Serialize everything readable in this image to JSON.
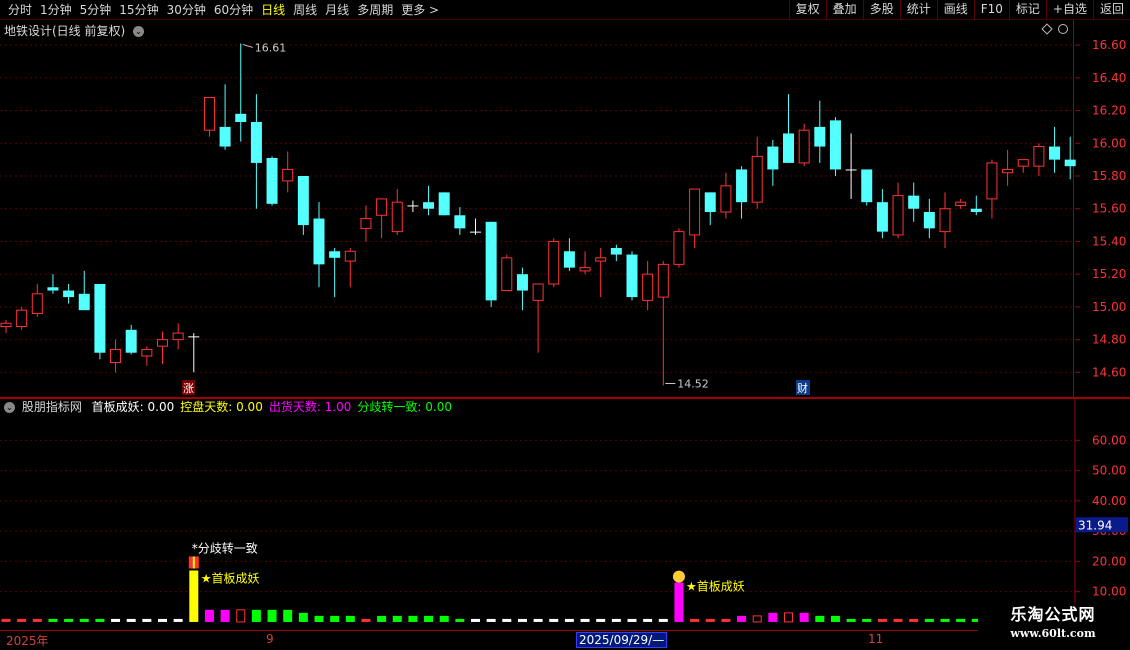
{
  "toolbar": {
    "periods": [
      {
        "label": "分时",
        "active": false
      },
      {
        "label": "1分钟",
        "active": false
      },
      {
        "label": "5分钟",
        "active": false
      },
      {
        "label": "15分钟",
        "active": false
      },
      {
        "label": "30分钟",
        "active": false
      },
      {
        "label": "60分钟",
        "active": false
      },
      {
        "label": "日线",
        "active": true
      },
      {
        "label": "周线",
        "active": false
      },
      {
        "label": "月线",
        "active": false
      },
      {
        "label": "多周期",
        "active": false
      },
      {
        "label": "更多 >",
        "active": false
      }
    ],
    "right_buttons": [
      "复权",
      "叠加",
      "多股",
      "统计",
      "画线",
      "F10",
      "标记",
      "+自选",
      "返回"
    ]
  },
  "main_chart": {
    "title": "地铁设计(日线 前复权)",
    "high_label": "16.61",
    "low_label": "14.52",
    "marker_zhang": "涨",
    "marker_cai": "财",
    "colors": {
      "up": "#ff3232",
      "down": "#54ffff",
      "flat": "#ffffff"
    }
  },
  "indicator": {
    "name": "股朋指标网",
    "items": [
      {
        "label": "首板成妖: 0.00",
        "color": "#ffffff"
      },
      {
        "label": "控盘天数: 0.00",
        "color": "#ffff00"
      },
      {
        "label": "出货天数: 1.00",
        "color": "#ff00ff"
      },
      {
        "label": "分歧转一致: 0.00",
        "color": "#00ff00"
      }
    ],
    "annotation_divergence": "*分歧转一致",
    "annotation_first_board_1": "★首板成妖",
    "annotation_first_board_2": "★首板成妖",
    "current_value": "31.94"
  },
  "date_axis": {
    "year_label": "2025年",
    "month_9": "9",
    "selected_date": "2025/09/29/—",
    "month_11": "11"
  },
  "watermark": {
    "line1": "乐淘公式网",
    "line2": "www.60lt.com"
  },
  "chart_data": {
    "type": "candlestick",
    "price_axis": {
      "ticks": [
        "16.60",
        "16.40",
        "16.20",
        "16.00",
        "15.80",
        "15.60",
        "15.40",
        "15.20",
        "15.00",
        "14.80",
        "14.60"
      ],
      "range": [
        14.48,
        16.68
      ]
    },
    "candles": [
      [
        14.88,
        14.92,
        14.84,
        14.9
      ],
      [
        14.88,
        15.0,
        14.86,
        14.98
      ],
      [
        14.96,
        15.14,
        14.94,
        15.08
      ],
      [
        15.12,
        15.2,
        15.08,
        15.1
      ],
      [
        15.1,
        15.14,
        15.02,
        15.06
      ],
      [
        15.08,
        15.22,
        15.02,
        14.98
      ],
      [
        15.14,
        15.14,
        14.68,
        14.72
      ],
      [
        14.66,
        14.8,
        14.6,
        14.74
      ],
      [
        14.86,
        14.89,
        14.71,
        14.72
      ],
      [
        14.7,
        14.76,
        14.64,
        14.74
      ],
      [
        14.76,
        14.85,
        14.65,
        14.8
      ],
      [
        14.8,
        14.9,
        14.74,
        14.84
      ],
      [
        14.82,
        14.84,
        14.6,
        14.82
      ],
      [
        16.08,
        16.28,
        16.04,
        16.28
      ],
      [
        16.1,
        16.36,
        15.96,
        15.98
      ],
      [
        16.18,
        16.61,
        16.01,
        16.13
      ],
      [
        16.13,
        16.3,
        15.6,
        15.88
      ],
      [
        15.91,
        15.92,
        15.62,
        15.63
      ],
      [
        15.77,
        15.95,
        15.7,
        15.84
      ],
      [
        15.8,
        15.8,
        15.44,
        15.5
      ],
      [
        15.54,
        15.64,
        15.12,
        15.26
      ],
      [
        15.34,
        15.36,
        15.06,
        15.3
      ],
      [
        15.28,
        15.36,
        15.12,
        15.34
      ],
      [
        15.48,
        15.62,
        15.4,
        15.54
      ],
      [
        15.56,
        15.66,
        15.42,
        15.66
      ],
      [
        15.46,
        15.72,
        15.44,
        15.64
      ],
      [
        15.62,
        15.65,
        15.58,
        15.62
      ],
      [
        15.64,
        15.74,
        15.56,
        15.6
      ],
      [
        15.7,
        15.7,
        15.56,
        15.56
      ],
      [
        15.56,
        15.61,
        15.44,
        15.48
      ],
      [
        15.46,
        15.54,
        15.44,
        15.46
      ],
      [
        15.52,
        15.52,
        15.0,
        15.04
      ],
      [
        15.1,
        15.32,
        15.1,
        15.3
      ],
      [
        15.2,
        15.24,
        14.98,
        15.1
      ],
      [
        15.04,
        15.14,
        14.72,
        15.14
      ],
      [
        15.14,
        15.42,
        15.12,
        15.4
      ],
      [
        15.34,
        15.42,
        15.22,
        15.24
      ],
      [
        15.22,
        15.34,
        15.2,
        15.24
      ],
      [
        15.28,
        15.36,
        15.06,
        15.3
      ],
      [
        15.36,
        15.38,
        15.28,
        15.32
      ],
      [
        15.32,
        15.34,
        15.04,
        15.06
      ],
      [
        15.04,
        15.28,
        14.98,
        15.2
      ],
      [
        15.06,
        15.28,
        14.52,
        15.26
      ],
      [
        15.26,
        15.48,
        15.24,
        15.46
      ],
      [
        15.44,
        15.72,
        15.36,
        15.72
      ],
      [
        15.7,
        15.7,
        15.5,
        15.58
      ],
      [
        15.58,
        15.82,
        15.54,
        15.74
      ],
      [
        15.84,
        15.86,
        15.54,
        15.64
      ],
      [
        15.64,
        16.04,
        15.6,
        15.92
      ],
      [
        15.98,
        16.02,
        15.74,
        15.84
      ],
      [
        16.06,
        16.3,
        15.9,
        15.88
      ],
      [
        15.88,
        16.12,
        15.86,
        16.08
      ],
      [
        16.1,
        16.26,
        15.88,
        15.98
      ],
      [
        16.14,
        16.16,
        15.8,
        15.84
      ],
      [
        15.84,
        16.06,
        15.66,
        15.84
      ],
      [
        15.84,
        15.84,
        15.62,
        15.64
      ],
      [
        15.64,
        15.72,
        15.42,
        15.46
      ],
      [
        15.44,
        15.76,
        15.42,
        15.68
      ],
      [
        15.68,
        15.76,
        15.52,
        15.6
      ],
      [
        15.58,
        15.66,
        15.42,
        15.48
      ],
      [
        15.46,
        15.7,
        15.36,
        15.6
      ],
      [
        15.62,
        15.66,
        15.6,
        15.64
      ],
      [
        15.6,
        15.68,
        15.56,
        15.58
      ],
      [
        15.66,
        15.9,
        15.54,
        15.88
      ],
      [
        15.82,
        15.96,
        15.74,
        15.84
      ],
      [
        15.86,
        15.9,
        15.82,
        15.9
      ],
      [
        15.86,
        16.0,
        15.8,
        15.98
      ],
      [
        15.98,
        16.1,
        15.82,
        15.9
      ],
      [
        15.9,
        16.04,
        15.78,
        15.86
      ]
    ],
    "indicator": {
      "axis_ticks": [
        "60.00",
        "50.00",
        "40.00",
        "30.00",
        "20.00",
        "10.00"
      ],
      "range": [
        -2,
        72
      ],
      "bars": [
        {
          "v": 1,
          "c": "red"
        },
        {
          "v": 1,
          "c": "red"
        },
        {
          "v": 1,
          "c": "red"
        },
        {
          "v": 1,
          "c": "green"
        },
        {
          "v": 1,
          "c": "green"
        },
        {
          "v": 1,
          "c": "green"
        },
        {
          "v": 1,
          "c": "green"
        },
        {
          "v": 1,
          "c": "white"
        },
        {
          "v": 1,
          "c": "white"
        },
        {
          "v": 1,
          "c": "white"
        },
        {
          "v": 1,
          "c": "white"
        },
        {
          "v": 1,
          "c": "white"
        },
        {
          "v": 17,
          "c": "yellow"
        },
        {
          "v": 4,
          "c": "magenta"
        },
        {
          "v": 4,
          "c": "magenta"
        },
        {
          "v": 4,
          "c": "red-outline"
        },
        {
          "v": 4,
          "c": "green"
        },
        {
          "v": 4,
          "c": "green"
        },
        {
          "v": 4,
          "c": "green"
        },
        {
          "v": 3,
          "c": "green"
        },
        {
          "v": 2,
          "c": "green"
        },
        {
          "v": 2,
          "c": "green"
        },
        {
          "v": 2,
          "c": "green"
        },
        {
          "v": 1,
          "c": "red"
        },
        {
          "v": 2,
          "c": "green"
        },
        {
          "v": 2,
          "c": "green"
        },
        {
          "v": 2,
          "c": "green"
        },
        {
          "v": 2,
          "c": "green"
        },
        {
          "v": 2,
          "c": "green"
        },
        {
          "v": 1,
          "c": "green"
        },
        {
          "v": 1,
          "c": "white"
        },
        {
          "v": 1,
          "c": "white"
        },
        {
          "v": 1,
          "c": "white"
        },
        {
          "v": 1,
          "c": "white"
        },
        {
          "v": 1,
          "c": "white"
        },
        {
          "v": 1,
          "c": "white"
        },
        {
          "v": 1,
          "c": "white"
        },
        {
          "v": 1,
          "c": "white"
        },
        {
          "v": 1,
          "c": "white"
        },
        {
          "v": 1,
          "c": "white"
        },
        {
          "v": 1,
          "c": "white"
        },
        {
          "v": 1,
          "c": "white"
        },
        {
          "v": 1,
          "c": "white"
        },
        {
          "v": 13,
          "c": "magenta"
        },
        {
          "v": 1,
          "c": "red"
        },
        {
          "v": 1,
          "c": "red"
        },
        {
          "v": 1,
          "c": "red"
        },
        {
          "v": 2,
          "c": "magenta"
        },
        {
          "v": 2,
          "c": "red-outline"
        },
        {
          "v": 3,
          "c": "magenta"
        },
        {
          "v": 3,
          "c": "red-outline"
        },
        {
          "v": 3,
          "c": "magenta"
        },
        {
          "v": 2,
          "c": "green"
        },
        {
          "v": 2,
          "c": "green"
        },
        {
          "v": 1,
          "c": "green"
        },
        {
          "v": 1,
          "c": "green"
        },
        {
          "v": 1,
          "c": "red"
        },
        {
          "v": 1,
          "c": "red"
        },
        {
          "v": 1,
          "c": "red"
        },
        {
          "v": 1,
          "c": "green"
        },
        {
          "v": 1,
          "c": "green"
        },
        {
          "v": 1,
          "c": "green"
        },
        {
          "v": 1,
          "c": "green"
        },
        {
          "v": 1,
          "c": "green"
        },
        {
          "v": 1,
          "c": "red"
        },
        {
          "v": 1,
          "c": "red"
        }
      ]
    }
  }
}
